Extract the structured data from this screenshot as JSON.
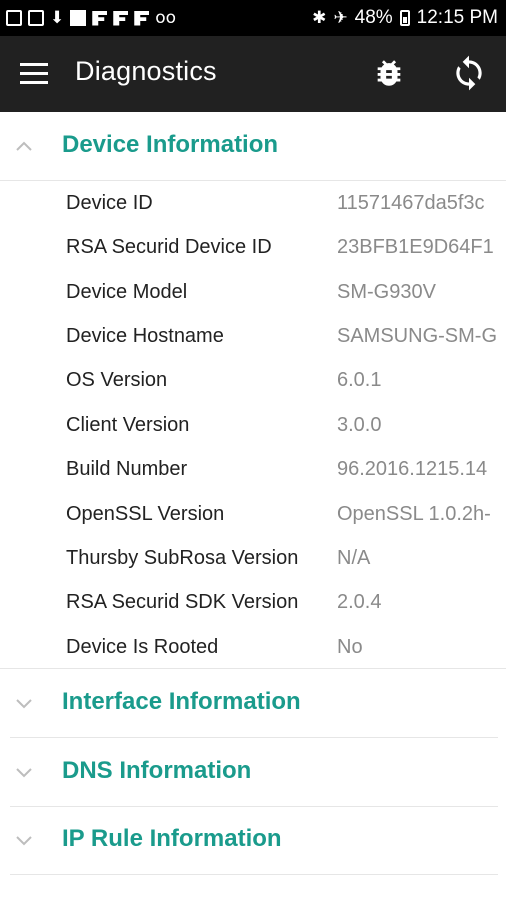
{
  "status_bar": {
    "battery": "48%",
    "time": "12:15 PM"
  },
  "app_bar": {
    "title": "Diagnostics"
  },
  "sections": [
    {
      "title": "Device Information",
      "expanded": true,
      "rows": [
        {
          "label": "Device ID",
          "value": "11571467da5f3c"
        },
        {
          "label": "RSA Securid Device ID",
          "value": "23BFB1E9D64F1"
        },
        {
          "label": "Device Model",
          "value": "SM-G930V"
        },
        {
          "label": "Device Hostname",
          "value": "SAMSUNG-SM-G"
        },
        {
          "label": "OS Version",
          "value": "6.0.1"
        },
        {
          "label": "Client Version",
          "value": "3.0.0"
        },
        {
          "label": "Build Number",
          "value": "96.2016.1215.14"
        },
        {
          "label": "OpenSSL Version",
          "value": "OpenSSL 1.0.2h-"
        },
        {
          "label": "Thursby SubRosa Version",
          "value": "N/A"
        },
        {
          "label": "RSA Securid SDK Version",
          "value": "2.0.4"
        },
        {
          "label": "Device Is Rooted",
          "value": "No"
        }
      ]
    },
    {
      "title": "Interface Information",
      "expanded": false
    },
    {
      "title": "DNS Information",
      "expanded": false
    },
    {
      "title": "IP Rule Information",
      "expanded": false
    }
  ],
  "colors": {
    "accent": "#1a9b8c",
    "app_bar": "#212121",
    "status_bar": "#000000",
    "value_text": "#8a8a8a"
  }
}
